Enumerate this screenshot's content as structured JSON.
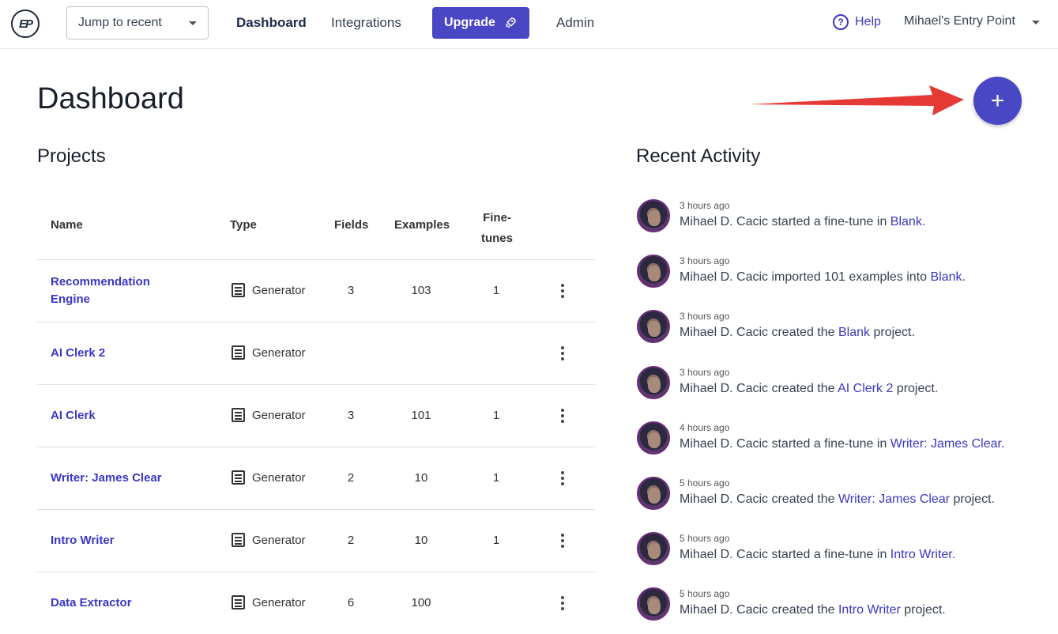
{
  "nav": {
    "logo": "EP",
    "jump_label": "Jump to recent",
    "links": [
      "Dashboard",
      "Integrations",
      "Admin"
    ],
    "upgrade_label": "Upgrade",
    "help_label": "Help",
    "account_label": "Mihael's Entry Point"
  },
  "page": {
    "title": "Dashboard",
    "fab_label": "+"
  },
  "projects": {
    "title": "Projects",
    "columns": [
      "Name",
      "Type",
      "Fields",
      "Examples",
      "Fine-tunes"
    ],
    "rows": [
      {
        "name": "Recommendation Engine",
        "type": "Generator",
        "fields": "3",
        "examples": "103",
        "finetunes": "1"
      },
      {
        "name": "AI Clerk 2",
        "type": "Generator",
        "fields": "",
        "examples": "",
        "finetunes": ""
      },
      {
        "name": "AI Clerk",
        "type": "Generator",
        "fields": "3",
        "examples": "101",
        "finetunes": "1"
      },
      {
        "name": "Writer: James Clear",
        "type": "Generator",
        "fields": "2",
        "examples": "10",
        "finetunes": "1"
      },
      {
        "name": "Intro Writer",
        "type": "Generator",
        "fields": "2",
        "examples": "10",
        "finetunes": "1"
      },
      {
        "name": "Data Extractor",
        "type": "Generator",
        "fields": "6",
        "examples": "100",
        "finetunes": ""
      }
    ]
  },
  "activity": {
    "title": "Recent Activity",
    "items": [
      {
        "time": "3 hours ago",
        "pre": "Mihael D. Cacic started a fine-tune in ",
        "link": "Blank.",
        "post": ""
      },
      {
        "time": "3 hours ago",
        "pre": "Mihael D. Cacic imported 101 examples into ",
        "link": "Blank",
        "post": "."
      },
      {
        "time": "3 hours ago",
        "pre": "Mihael D. Cacic created the ",
        "link": "Blank",
        "post": " project."
      },
      {
        "time": "3 hours ago",
        "pre": "Mihael D. Cacic created the ",
        "link": "AI Clerk 2",
        "post": " project."
      },
      {
        "time": "4 hours ago",
        "pre": "Mihael D. Cacic started a fine-tune in ",
        "link": "Writer: James Clear.",
        "post": ""
      },
      {
        "time": "5 hours ago",
        "pre": "Mihael D. Cacic created the ",
        "link": "Writer: James Clear",
        "post": " project."
      },
      {
        "time": "5 hours ago",
        "pre": "Mihael D. Cacic started a fine-tune in ",
        "link": "Intro Writer.",
        "post": ""
      },
      {
        "time": "5 hours ago",
        "pre": "Mihael D. Cacic created the ",
        "link": "Intro Writer",
        "post": " project."
      }
    ]
  },
  "colors": {
    "accent": "#4a47c4",
    "link": "#3b37c4",
    "annotation_arrow": "#e53935"
  }
}
